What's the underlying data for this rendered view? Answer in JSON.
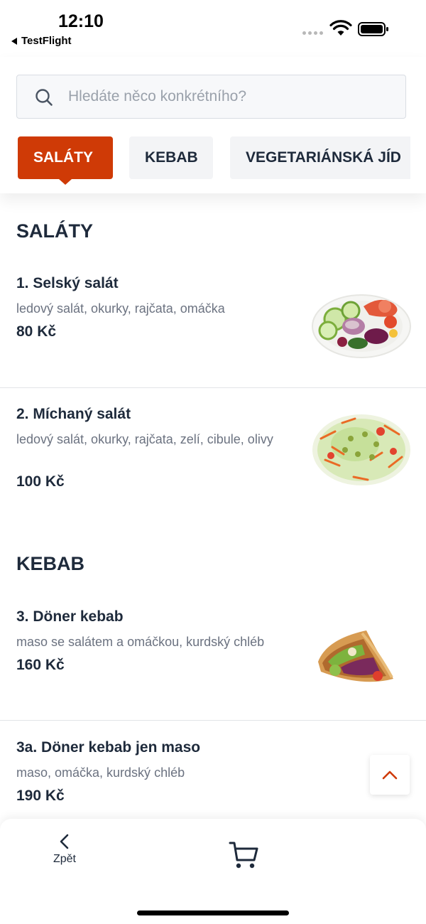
{
  "status_bar": {
    "time": "12:10",
    "back_app": "TestFlight"
  },
  "search": {
    "placeholder": "Hledáte něco konkrétního?",
    "value": ""
  },
  "tabs": [
    {
      "label": "SALÁTY",
      "active": true
    },
    {
      "label": "KEBAB",
      "active": false
    },
    {
      "label": "VEGETARIÁNSKÁ JÍD",
      "active": false
    }
  ],
  "sections": [
    {
      "title": "SALÁTY",
      "items": [
        {
          "name": "1. Selský salát",
          "description": "ledový salát, okurky, rajčata, omáčka",
          "price": "80 Kč",
          "image": "salad-plate"
        },
        {
          "name": "2. Míchaný salát",
          "description": "ledový salát, okurky, rajčata, zelí, cibule, olivy",
          "price": "100 Kč",
          "image": "mixed-salad"
        }
      ]
    },
    {
      "title": "KEBAB",
      "items": [
        {
          "name": "3. Döner kebab",
          "description": "maso se salátem a omáčkou, kurdský chléb",
          "price": "160 Kč",
          "image": "doner-kebab"
        },
        {
          "name": "3a. Döner kebab jen maso",
          "description": "maso, omáčka, kurdský chléb",
          "price": "190 Kč",
          "image": ""
        }
      ]
    }
  ],
  "bottom_nav": {
    "back_label": "Zpět",
    "back_icon": "chevron-left-icon",
    "cart_icon": "cart-icon"
  },
  "colors": {
    "accent": "#cf3a06",
    "text": "#1e2a3b",
    "muted": "#6b7280"
  }
}
